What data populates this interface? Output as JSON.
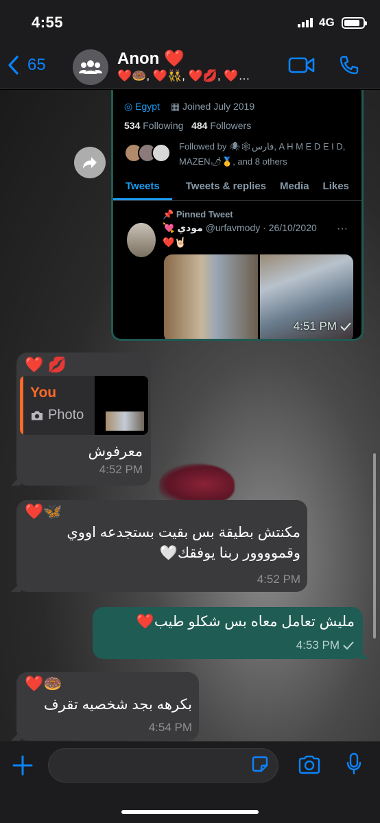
{
  "status_bar": {
    "time": "4:55",
    "network": "4G",
    "battery_level": 0.85
  },
  "header": {
    "back_count": "65",
    "title": "Anon ❤️",
    "subtitle": "❤️🍩, ❤️👯, ❤️💋, ❤️…"
  },
  "tweet_screenshot": {
    "location": "Egypt",
    "joined": "Joined July 2019",
    "following_count": "534",
    "following_label": "Following",
    "followers_count": "484",
    "followers_label": "Followers",
    "followed_by": "Followed by 🕷🕸فارس, A H M E D E I D, MAZEN🌶🥇, and 8 others",
    "tabs": [
      "Tweets",
      "Tweets & replies",
      "Media",
      "Likes"
    ],
    "pinned_label": "Pinned Tweet",
    "pinned_name": "💘 مودي",
    "pinned_handle": "@urfavmody · 26/10/2020",
    "pinned_text": "❤️🤘🏻",
    "time": "4:51 PM",
    "status": "read"
  },
  "messages": [
    {
      "direction": "in",
      "sender": "❤️ 💋",
      "quote_author": "You",
      "quote_type": "Photo",
      "text": "معرفوش",
      "time": "4:52 PM"
    },
    {
      "direction": "in",
      "sender": "❤️🦋",
      "text_line1": "مكنتش بطيقة بس بقيت بستجدعه اووي",
      "text_line2": "وقموووور ربنا يوفقك🤍",
      "time": "4:52 PM"
    },
    {
      "direction": "out",
      "text": "مليش تعامل معاه بس شكلو طيب❤️",
      "time": "4:53 PM",
      "status": "delivered"
    },
    {
      "direction": "in",
      "sender": "❤️🍩",
      "text": "بكرهه بجد شخصيه تقرف",
      "time": "4:54 PM"
    }
  ],
  "colors": {
    "accent": "#0a84ff",
    "outgoing_bubble": "#1f5c54",
    "incoming_bubble": "#3a3a3c",
    "quote_accent": "#ff6a28"
  },
  "icons": [
    "back-chevron-icon",
    "group-icon",
    "video-call-icon",
    "phone-icon",
    "forward-icon",
    "plus-icon",
    "sticker-icon",
    "camera-icon",
    "microphone-icon"
  ]
}
